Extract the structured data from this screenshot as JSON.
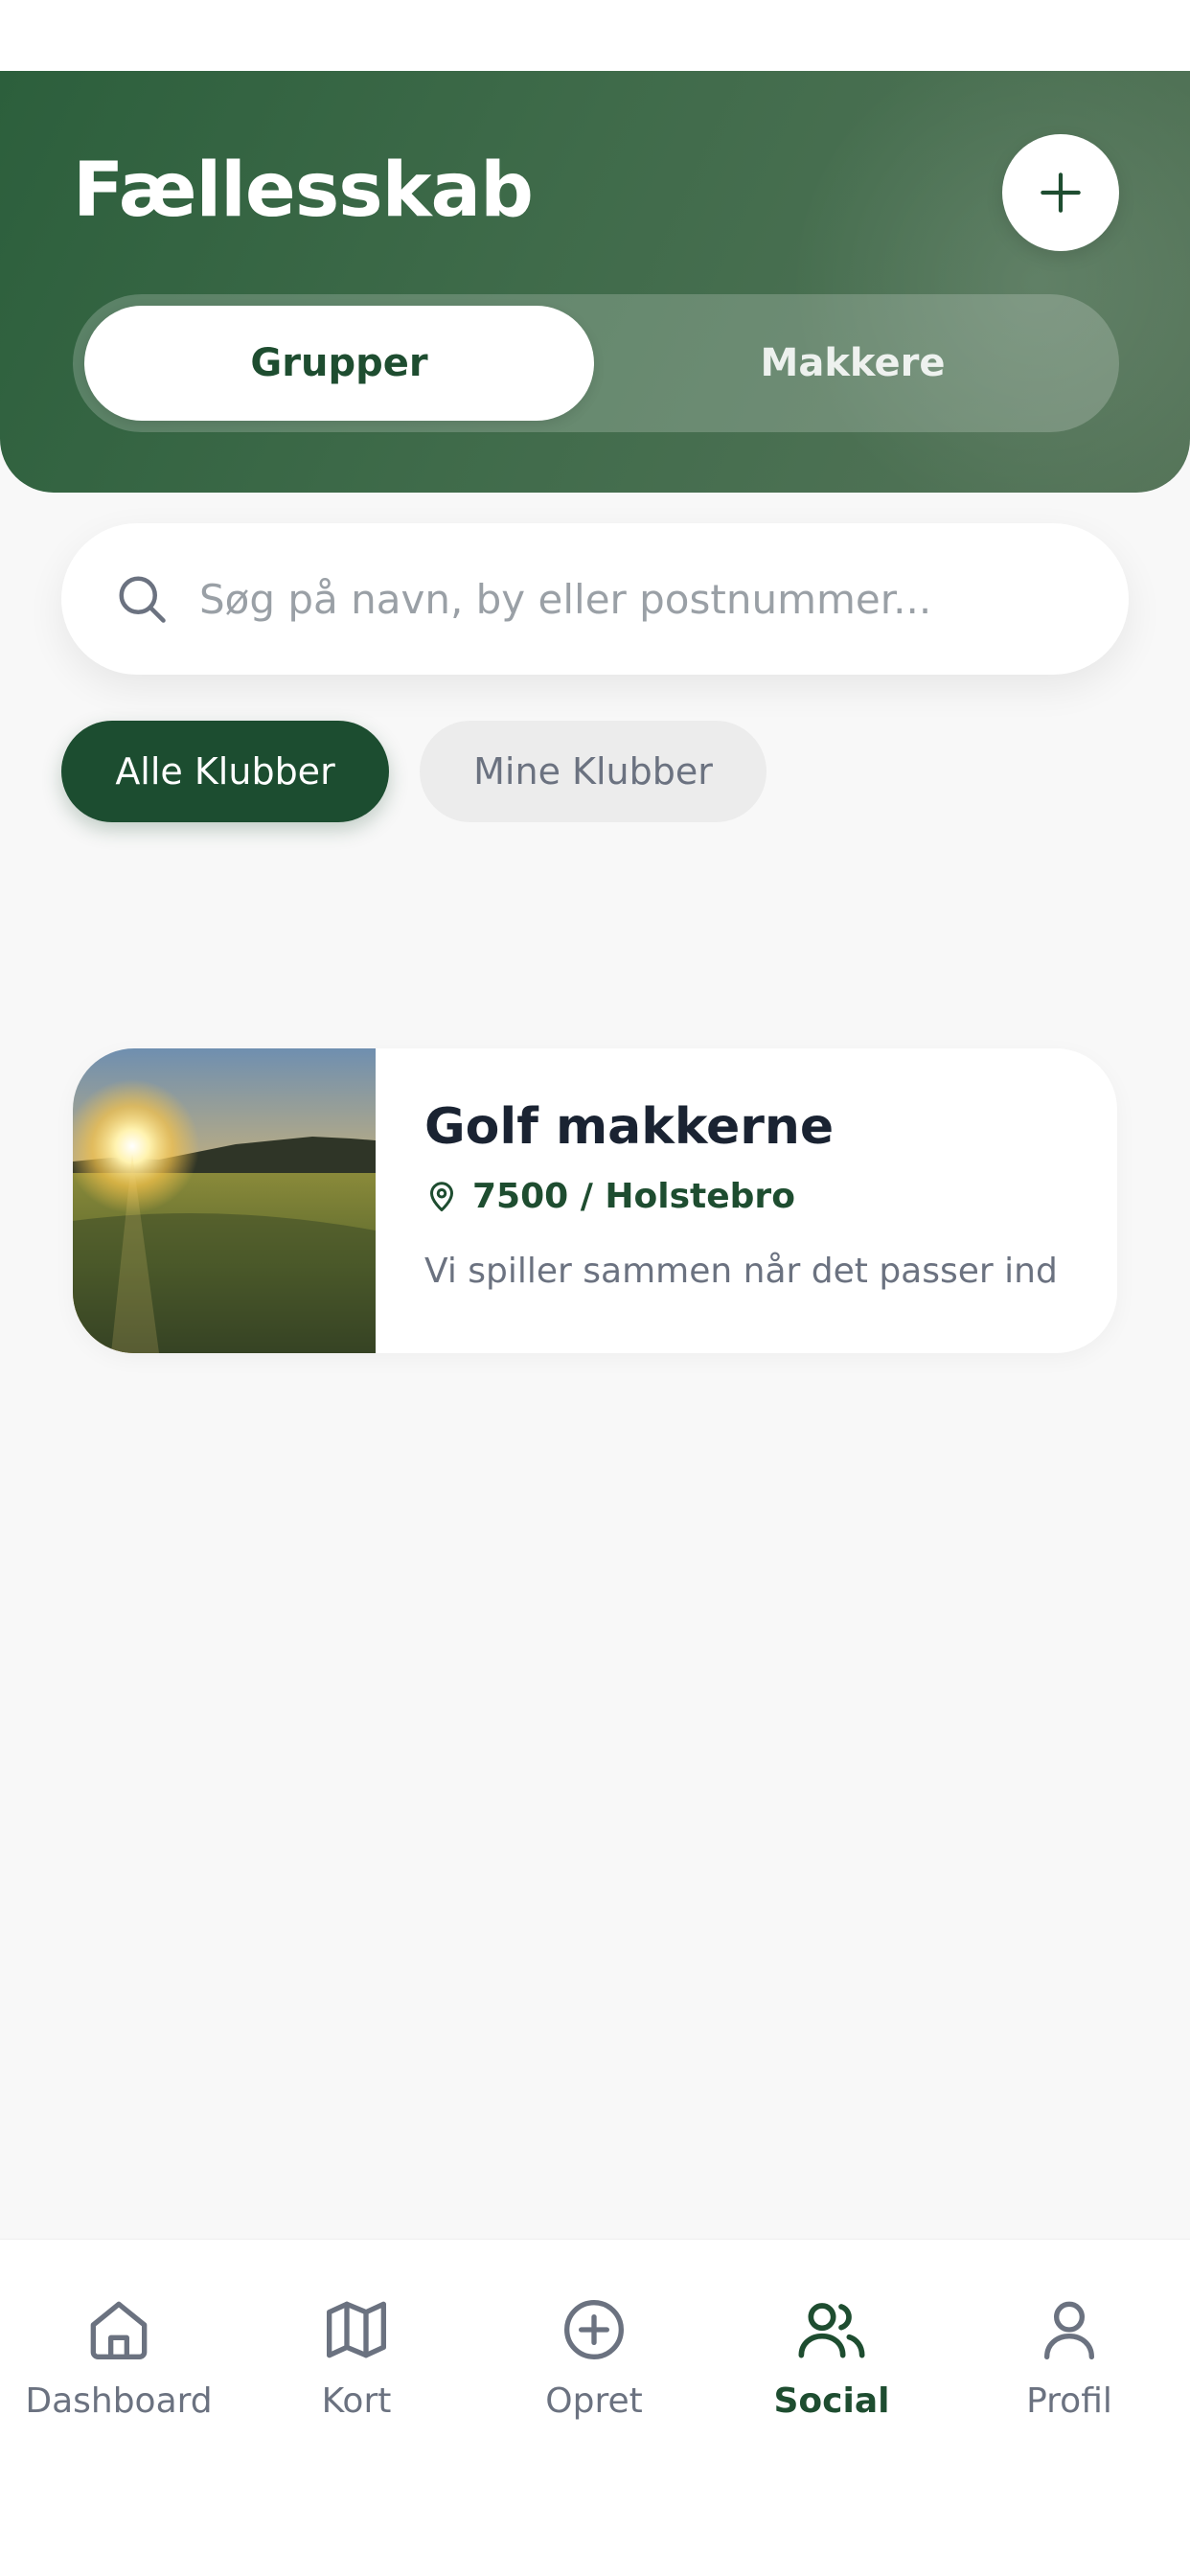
{
  "header": {
    "title": "Fællesskab",
    "add_icon": "plus-icon",
    "tabs": [
      {
        "label": "Grupper",
        "active": true
      },
      {
        "label": "Makkere",
        "active": false
      }
    ]
  },
  "search": {
    "icon": "search-icon",
    "placeholder": "Søg på navn, by eller postnummer..."
  },
  "filters": [
    {
      "label": "Alle Klubber",
      "active": true
    },
    {
      "label": "Mine Klubber",
      "active": false
    }
  ],
  "groups": [
    {
      "title": "Golf makkerne",
      "location": "7500 / Holstebro",
      "location_icon": "map-pin-icon",
      "description": "Vi spiller sammen når det passer ind",
      "image": "golf-course-sunset-photo"
    }
  ],
  "bottom_nav": [
    {
      "label": "Dashboard",
      "icon": "home-icon",
      "active": false
    },
    {
      "label": "Kort",
      "icon": "map-icon",
      "active": false
    },
    {
      "label": "Opret",
      "icon": "plus-circle-icon",
      "active": false
    },
    {
      "label": "Social",
      "icon": "users-icon",
      "active": true
    },
    {
      "label": "Profil",
      "icon": "user-icon",
      "active": false
    }
  ],
  "colors": {
    "primary": "#1e4d30",
    "header_gradient_start": "#2c5f3c",
    "header_gradient_end": "#56755a",
    "muted_text": "#6b7280",
    "title_text": "#1a2332"
  }
}
